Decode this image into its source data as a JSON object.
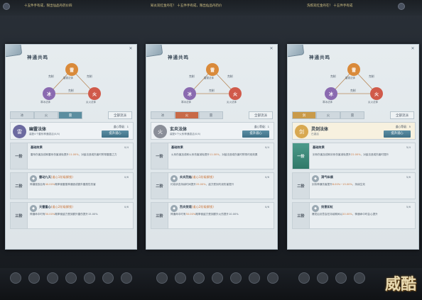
{
  "topbar": {
    "left_notice": "十五件手有成，限出仙品丹药价四",
    "mid_notice": "知炎双红金丹在！ 十五件手有成，限出仙品丹药价",
    "right_notice": "洗炼双红金丹在！ 十五件手有成"
  },
  "panels": [
    {
      "title": "神通共鸣",
      "triangle": {
        "top": "雷",
        "left": "冰",
        "right": "火",
        "top_label": "雷霆法体",
        "left_label": "寒冰法体",
        "right_label": "炎火法体",
        "rel1": "克制",
        "rel2": "克制",
        "rel3": "克制"
      },
      "tabs": [
        "冰",
        "火",
        "雷"
      ],
      "active_tab": 2,
      "tab_color": "#5c8ea0",
      "extra_button": "全部流派",
      "stance": {
        "name": "幽雷法体",
        "sub": "装配4个雷系神通激活(0/4)",
        "level": "道心等级：1",
        "button": "提升道心",
        "icon_color": "#6c6aa0",
        "icon": "雷"
      },
      "tiers": [
        {
          "badge": "一阶",
          "on": false,
          "name": "基础效果",
          "req": "",
          "count": "0/4",
          "desc_a": "雷系伤害加成和雷系伤害减免提升",
          "desc_hl": "11.00%",
          "desc_b": "，对敌法造成伤害时附带雷霆之力"
        },
        {
          "badge": "二阶",
          "on": false,
          "name": "雷动九天",
          "req": "(道心1阶级解锁)",
          "count": "0/6",
          "desc_a": "神通施放后有",
          "desc_hl": "40.00%",
          "desc_b": "概率使雷霆神通造成额外雷属性伤害"
        },
        {
          "badge": "三阶",
          "on": false,
          "name": "天雷重心",
          "req": "(道心2阶级解锁)",
          "count": "0/6",
          "desc_a": "神通命中时有",
          "desc_hl": "50.00%",
          "desc_b": "概率使敌方受到额外雷伤提升15.00%"
        }
      ]
    },
    {
      "title": "神通共鸣",
      "triangle": {
        "top": "雷",
        "left": "冰",
        "right": "火",
        "top_label": "雷霆法体",
        "left_label": "寒冰法体",
        "right_label": "炎火法体",
        "rel1": "克制",
        "rel2": "克制",
        "rel3": "克制"
      },
      "tabs": [
        "冰",
        "火",
        "雷"
      ],
      "active_tab": 1,
      "tab_color": "#c86a48",
      "extra_button": "全部流派",
      "stance": {
        "name": "玄炎法体",
        "sub": "装配4个火系神通激活(0/4)",
        "level": "道心等级：1",
        "button": "提升道心",
        "icon_color": "#8a8e98",
        "icon": "火"
      },
      "tiers": [
        {
          "badge": "一阶",
          "on": false,
          "name": "基础效果",
          "req": "",
          "count": "0/4",
          "desc_a": "火系伤害加成和火系伤害减免提升",
          "desc_hl": "11.00%",
          "desc_b": "，对敌法造成伤害时附带灼烧效果"
        },
        {
          "badge": "二阶",
          "on": false,
          "name": "炎炎烈焰",
          "req": "(道心1阶级解锁)",
          "count": "0/6",
          "desc_a": "灼烧状态持续时间提升",
          "desc_hl": "25.00%",
          "desc_b": "，敌方受到灼烧伤害提升"
        },
        {
          "badge": "三阶",
          "on": false,
          "name": "烈炎焚境",
          "req": "(道心2阶级解锁)",
          "count": "0/6",
          "desc_a": "神通命中时有",
          "desc_hl": "50.00%",
          "desc_b": "概率使敌方受到额外火伤提升10.00%"
        }
      ]
    },
    {
      "title": "神通共鸣",
      "triangle": {
        "top": "雷",
        "left": "冰",
        "right": "火",
        "top_label": "雷霆法体",
        "left_label": "寒冰法体",
        "right_label": "炎火法体",
        "rel1": "克制",
        "rel2": "克制",
        "rel3": "克制"
      },
      "tabs": [
        "剑",
        "火",
        "雷"
      ],
      "active_tab": 0,
      "tab_color": "#c99a4a",
      "extra_button": "全部流派",
      "stance": {
        "name": "灵剑法体",
        "sub": "已激活",
        "level": "道心等级：5",
        "button": "提升道心",
        "icon_color": "#d8a850",
        "icon": "剑"
      },
      "tiers": [
        {
          "badge": "一阶",
          "on": true,
          "name": "基础效果",
          "req": "",
          "count": "5/4",
          "desc_a": "剑系伤害加成和剑系伤害减免提升",
          "desc_hl": "22.00%",
          "desc_b": "，对敌法造成伤害时提升"
        },
        {
          "badge": "二阶",
          "on": false,
          "name": "洞气纵横",
          "req": "",
          "count": "5/6",
          "desc_a": "剑系神通伤害提升",
          "desc_hl": "8.00%~15.00%",
          "desc_b": "，持续生效"
        },
        {
          "badge": "三阶",
          "on": false,
          "name": "剑意如虹",
          "req": "",
          "count": "5/6",
          "desc_a": "爆发后剑意会在持续期间以",
          "desc_hl": "20.00%",
          "desc_b": "，神通命中时会心提升"
        }
      ]
    }
  ],
  "watermark": "威酷"
}
